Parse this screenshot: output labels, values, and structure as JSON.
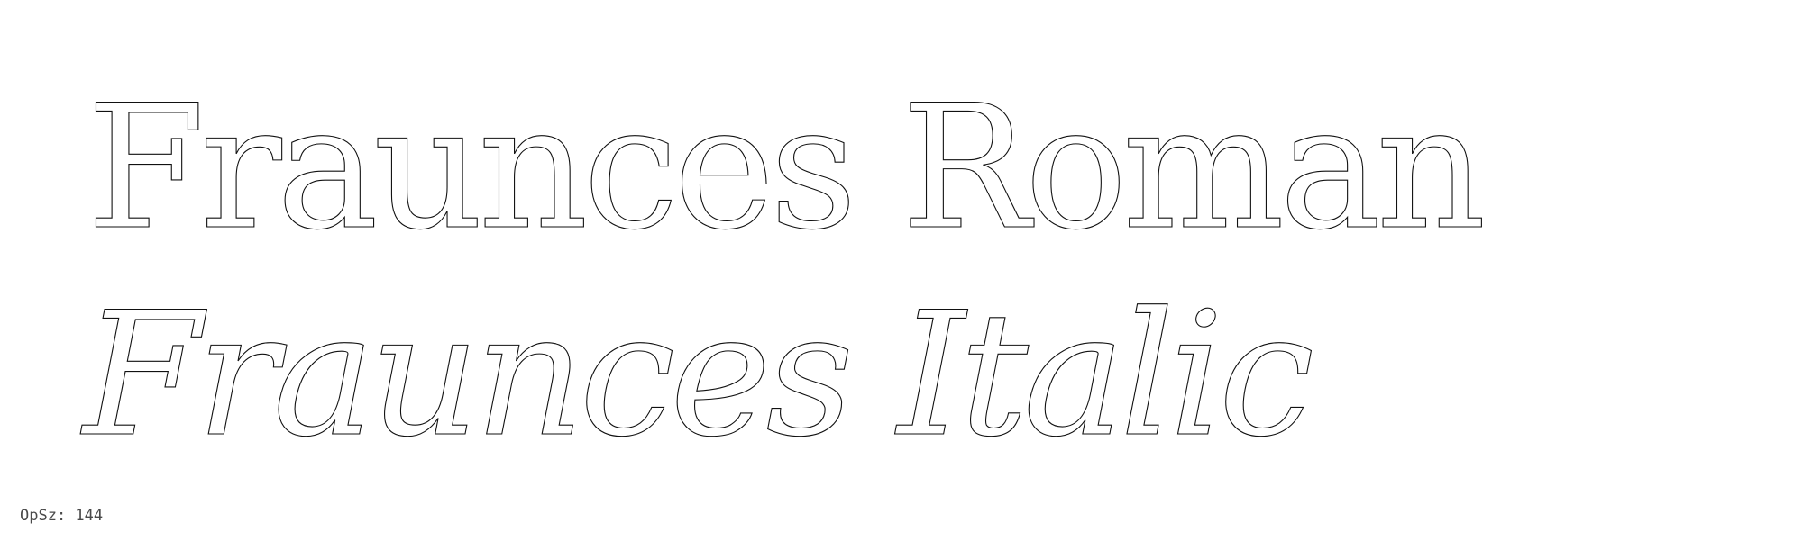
{
  "specimen": {
    "roman_text": "Fraunces Roman",
    "italic_text": "Fraunces Italic",
    "opsz_label": "OpSz: 144"
  },
  "colors": {
    "background": "#ffffff",
    "glyph_fill": "#ffffff",
    "glyph_outline": "#111111",
    "label_text": "#4a4a4a"
  }
}
